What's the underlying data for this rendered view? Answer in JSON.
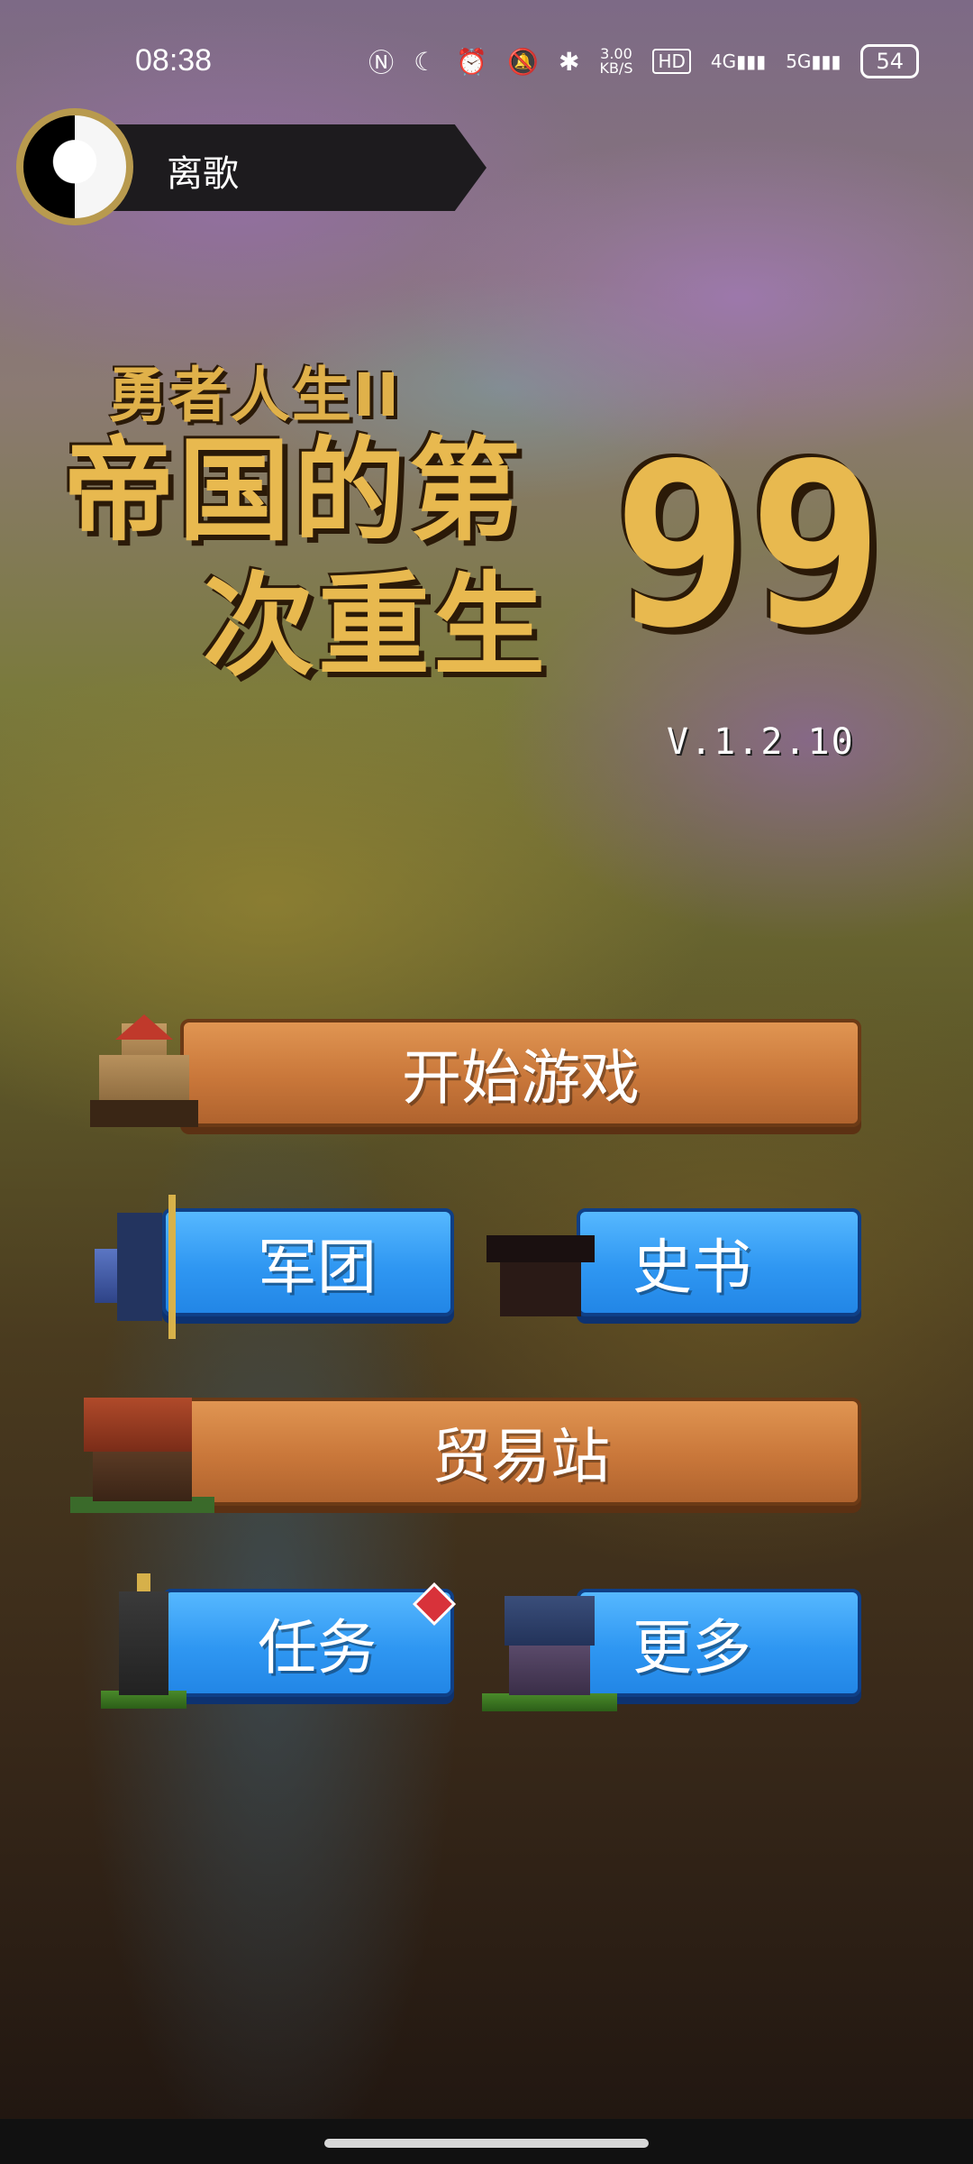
{
  "status_bar": {
    "time": "08:38",
    "network_speed": "3.00\nKB/S",
    "signal_4g": "4G",
    "signal_5g": "5G",
    "battery": "54"
  },
  "profile": {
    "name": "离歌"
  },
  "title": {
    "subtitle": "勇者人生II",
    "line1": "帝国的第",
    "line2": "次重生",
    "number": "99",
    "version": "V.1.2.10"
  },
  "menu": {
    "start_game": "开始游戏",
    "legion": "军团",
    "history_book": "史书",
    "trading_post": "贸易站",
    "tasks": "任务",
    "more": "更多"
  },
  "colors": {
    "orange_button": "#d0813f",
    "blue_button": "#2f97f2",
    "title_gold": "#e8b94f",
    "badge_red": "#d8323a"
  }
}
